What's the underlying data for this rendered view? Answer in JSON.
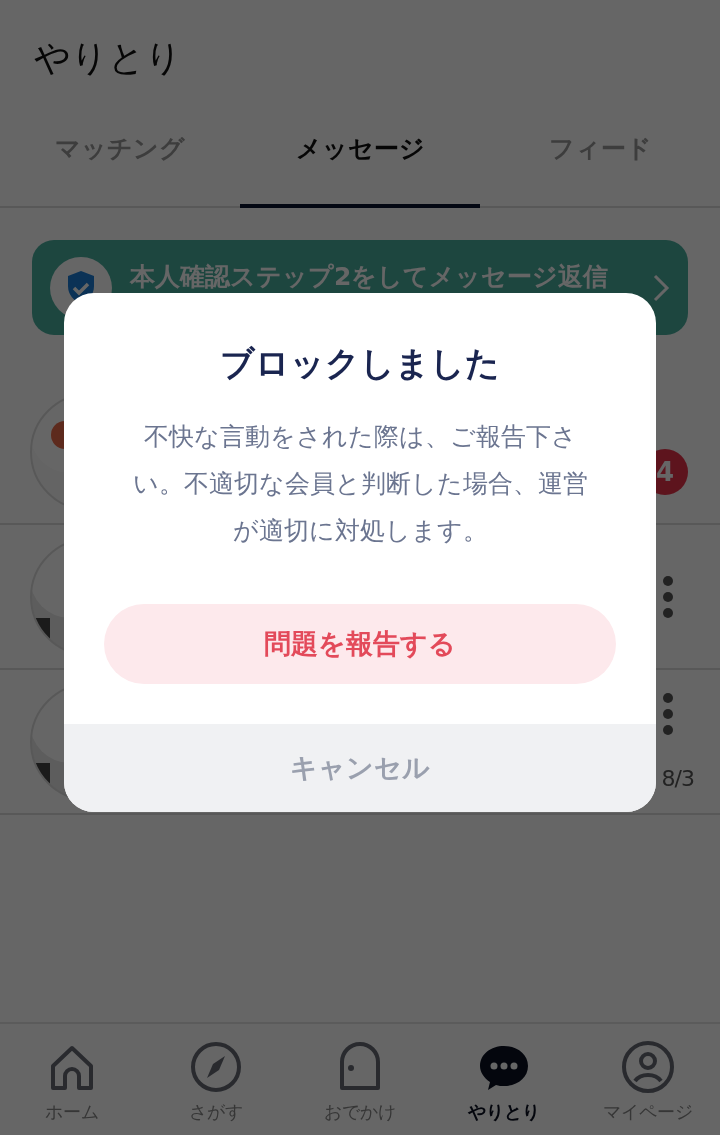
{
  "header": {
    "title": "やりとり"
  },
  "tabs": [
    {
      "label": "マッチング",
      "selected": false
    },
    {
      "label": "メッセージ",
      "selected": true
    },
    {
      "label": "フィード",
      "selected": false
    }
  ],
  "banner": {
    "text": "本人確認ステップ2をしてメッセージ返信"
  },
  "conversations": [
    {
      "kind": "badge",
      "unread": "4"
    },
    {
      "kind": "menu"
    },
    {
      "kind": "menu",
      "date": "8/3"
    }
  ],
  "dialog": {
    "title": "ブロックしました",
    "message": "不快な言動をされた際は、ご報告下さい。不適切な会員と判断した場合、運営が適切に対処します。",
    "report_button": "問題を報告する",
    "cancel_button": "キャンセル"
  },
  "nav": [
    {
      "kind": "home",
      "label": "ホーム",
      "selected": false
    },
    {
      "kind": "compass",
      "label": "さがす",
      "selected": false
    },
    {
      "kind": "door",
      "label": "おでかけ",
      "selected": false
    },
    {
      "kind": "chat",
      "label": "やりとり",
      "selected": true
    },
    {
      "kind": "person",
      "label": "マイページ",
      "selected": false
    }
  ]
}
